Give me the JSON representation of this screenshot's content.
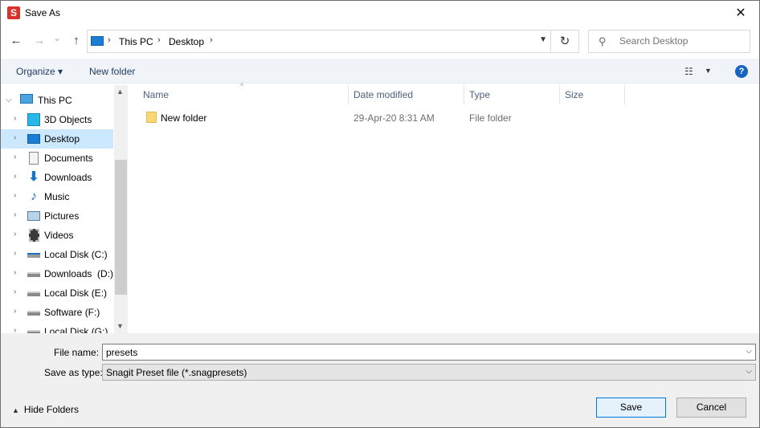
{
  "window": {
    "title": "Save As",
    "app_icon_letter": "S",
    "close_glyph": "✕",
    "accent": "#0078d7",
    "app_icon_color": "#d9342b"
  },
  "nav": {
    "back_glyph": "←",
    "forward_glyph": "→",
    "recent_glyph": "⌄",
    "up_glyph": "↑",
    "breadcrumbs": [
      "This PC",
      "Desktop"
    ],
    "crumb_sep": "›",
    "refresh_glyph": "↻",
    "search_placeholder": "Search Desktop"
  },
  "commands": {
    "organize": "Organize ▾",
    "new_folder": "New folder",
    "view_glyph": "☷",
    "help": "?"
  },
  "tree": {
    "root": "This PC",
    "items": [
      {
        "label": "3D Objects",
        "icon": "cube-icon"
      },
      {
        "label": "Desktop",
        "icon": "desktop-icon",
        "selected": true
      },
      {
        "label": "Documents",
        "icon": "document-icon"
      },
      {
        "label": "Downloads",
        "icon": "download-icon"
      },
      {
        "label": "Music",
        "icon": "music-icon"
      },
      {
        "label": "Pictures",
        "icon": "pictures-icon"
      },
      {
        "label": "Videos",
        "icon": "videos-icon"
      },
      {
        "label": "Local Disk (C:)",
        "icon": "drive-icon"
      },
      {
        "label": "Downloads  (D:)",
        "icon": "drive-icon"
      },
      {
        "label": "Local Disk (E:)",
        "icon": "drive-icon"
      },
      {
        "label": "Software (F:)",
        "icon": "drive-icon"
      },
      {
        "label": "Local Disk (G:)",
        "icon": "drive-icon"
      }
    ]
  },
  "columns": {
    "name": "Name",
    "date": "Date modified",
    "type": "Type",
    "size": "Size"
  },
  "files": [
    {
      "name": "New folder",
      "date": "29-Apr-20 8:31 AM",
      "type": "File folder",
      "size": ""
    }
  ],
  "form": {
    "filename_label": "File name:",
    "filename_value": "presets",
    "savetype_label": "Save as type:",
    "savetype_value": "Snagit Preset file (*.snagpresets)",
    "hide_folders": "Hide Folders",
    "save": "Save",
    "cancel": "Cancel"
  }
}
